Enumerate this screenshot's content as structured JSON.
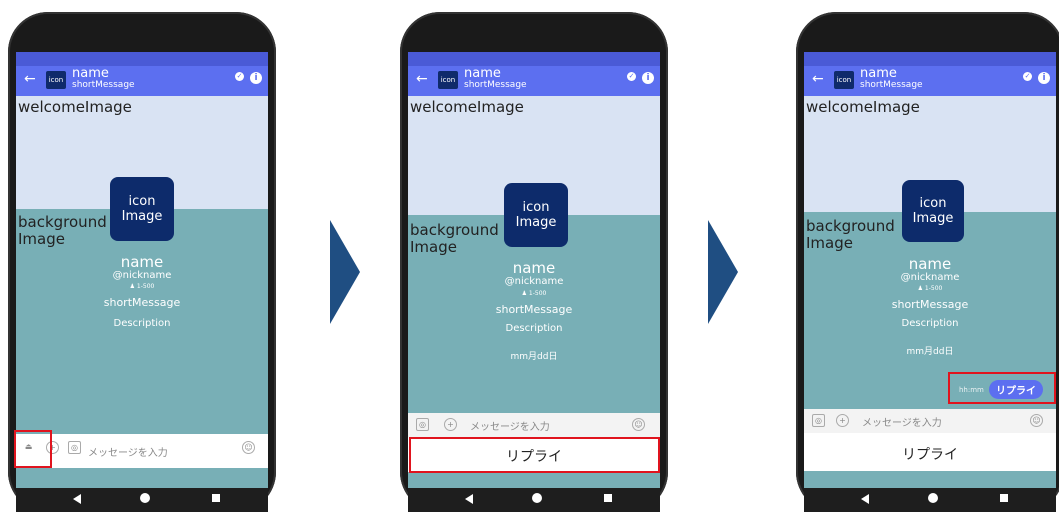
{
  "header": {
    "back_icon": "←",
    "icon_label": "icon",
    "name": "name",
    "short_message": "shortMessage",
    "check_icon": "✓",
    "info_icon": "i"
  },
  "welcome_image_label": "welcomeImage",
  "background_image_label": "background\nImage",
  "icon_image_label": "icon\nImage",
  "profile": {
    "name": "name",
    "nickname": "@nickname",
    "follower_count": "♟ 1-500",
    "short_message": "shortMessage",
    "description": "Description",
    "date": "mm月dd日"
  },
  "input": {
    "placeholder": "メッセージを入力",
    "plus_icon": "+",
    "camera_icon": "◎",
    "emoji_icon": "☺",
    "toggle_icon": "⏏"
  },
  "reply": {
    "label": "リプライ",
    "time": "hh:mm",
    "pill_label": "リプライ"
  },
  "colors": {
    "header": "#5c6ff0",
    "welcome_bg": "#d9e3f3",
    "background_bg": "#78afb6",
    "icon_bg": "#0d2b6b",
    "arrow": "#1f4e82",
    "highlight": "#e0141e"
  }
}
